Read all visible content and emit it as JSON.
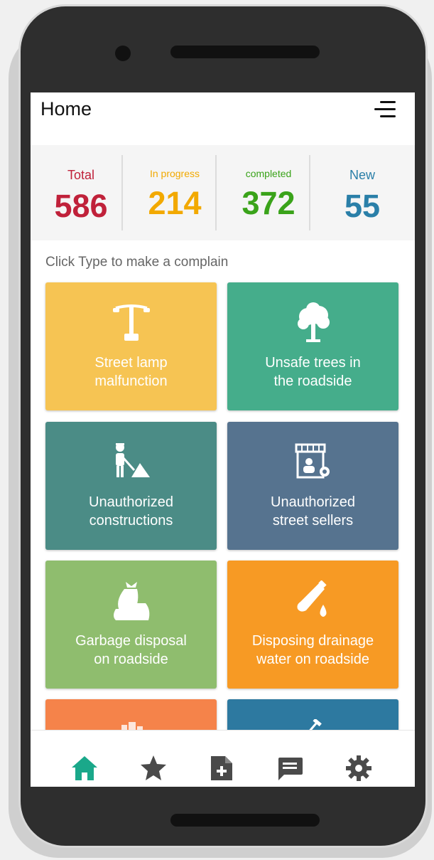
{
  "header": {
    "title": "Home",
    "menu_icon": "menu-icon"
  },
  "stats": [
    {
      "label": "Total",
      "value": "586",
      "color": "#c0213a"
    },
    {
      "label": "In progress",
      "value": "214",
      "color": "#f2a900"
    },
    {
      "label": "completed",
      "value": "372",
      "color": "#3aa31a"
    },
    {
      "label": "New",
      "value": "55",
      "color": "#2a7fa8"
    }
  ],
  "prompt": "Click Type to make a complain",
  "tiles": [
    {
      "label_line1": "Street lamp",
      "label_line2": "malfunction",
      "icon": "street-lamp-icon",
      "color": "#f6c453"
    },
    {
      "label_line1": "Unsafe trees in",
      "label_line2": "the roadside",
      "icon": "tree-icon",
      "color": "#45ad8b"
    },
    {
      "label_line1": "Unauthorized",
      "label_line2": "constructions",
      "icon": "construction-worker-icon",
      "color": "#4b8c86"
    },
    {
      "label_line1": "Unauthorized",
      "label_line2": "street sellers",
      "icon": "street-seller-icon",
      "color": "#56738f"
    },
    {
      "label_line1": "Garbage disposal",
      "label_line2": "on roadside",
      "icon": "garbage-bag-icon",
      "color": "#8fbd6e"
    },
    {
      "label_line1": "Disposing drainage",
      "label_line2": "water on roadside",
      "icon": "drainage-water-icon",
      "color": "#f79a24"
    }
  ],
  "partial_tiles": [
    {
      "icon": "building-icon",
      "color": "#f5834a"
    },
    {
      "icon": "hammer-icon",
      "color": "#2d79a0"
    }
  ],
  "bottom_nav": [
    {
      "icon": "home-icon",
      "active": true,
      "color": "#1aa88a"
    },
    {
      "icon": "star-icon",
      "active": false,
      "color": "#4a4a4a"
    },
    {
      "icon": "add-document-icon",
      "active": false,
      "color": "#4a4a4a"
    },
    {
      "icon": "message-icon",
      "active": false,
      "color": "#4a4a4a"
    },
    {
      "icon": "settings-gear-icon",
      "active": false,
      "color": "#4a4a4a"
    }
  ]
}
